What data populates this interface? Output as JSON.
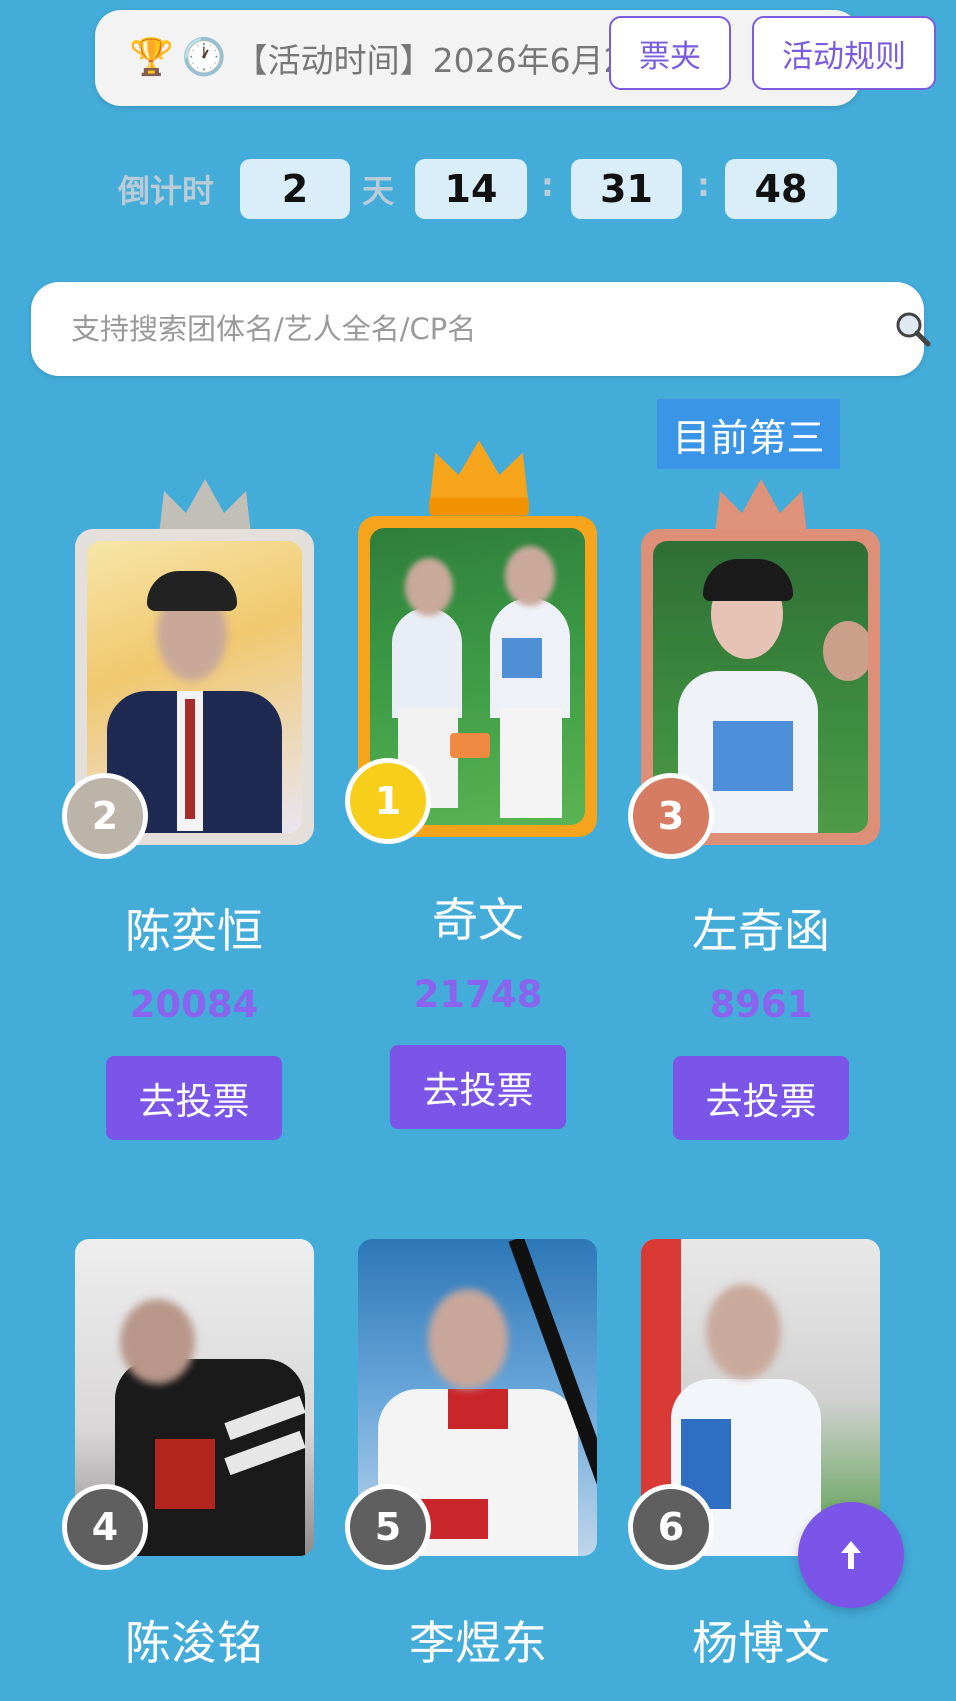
{
  "notice": {
    "icons": [
      "trophy-icon",
      "clock-icon"
    ],
    "text": "【活动时间】2026年6月2",
    "ellipsis": "...",
    "ticket_button": "票夹",
    "rules_button": "活动规则"
  },
  "countdown": {
    "label": "倒计时",
    "days": "2",
    "day_unit": "天",
    "hours": "14",
    "sep1": ":",
    "minutes": "31",
    "sep2": ":",
    "seconds": "48"
  },
  "search": {
    "placeholder": "支持搜索团体名/艺人全名/CP名",
    "icon": "search-icon"
  },
  "status_tag": "目前第三",
  "podium": [
    {
      "rank": "2",
      "name": "陈奕恒",
      "votes": "20084",
      "button": "去投票"
    },
    {
      "rank": "1",
      "name": "奇文",
      "votes": "21748",
      "button": "去投票"
    },
    {
      "rank": "3",
      "name": "左奇函",
      "votes": "8961",
      "button": "去投票"
    }
  ],
  "list": [
    {
      "rank": "4",
      "name": "陈浚铭"
    },
    {
      "rank": "5",
      "name": "李煜东"
    },
    {
      "rank": "6",
      "name": "杨博文"
    }
  ],
  "colors": {
    "background": "#43acd9",
    "accent": "#7b55e8",
    "gold": "#f7a41d",
    "silver": "#bfb6ad",
    "bronze": "#d98a72",
    "rank_badge_gray": "#5f5f5f"
  },
  "fab_icon": "arrow-up-icon"
}
